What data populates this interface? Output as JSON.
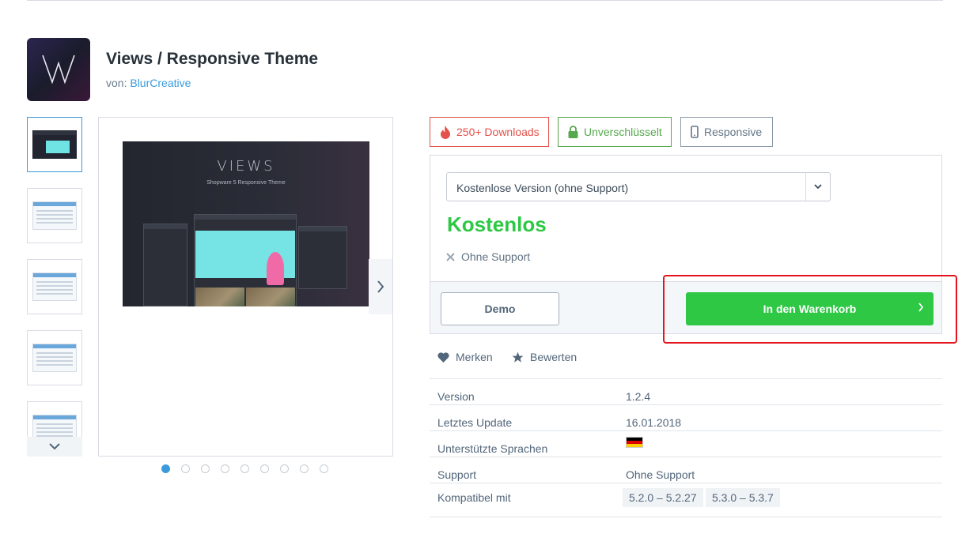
{
  "product": {
    "title": "Views / Responsive Theme",
    "by_prefix": "von:",
    "author": "BlurCreative"
  },
  "gallery": {
    "hero_brand": "VIEWS",
    "hero_subtitle": "Shopware 5 Responsive Theme",
    "hero_window_text": "views",
    "dot_count": 9,
    "active_dot": 1
  },
  "badges": {
    "downloads": "250+ Downloads",
    "encryption": "Unverschlüsselt",
    "responsive": "Responsive"
  },
  "buybox": {
    "version_select": "Kostenlose Version (ohne Support)",
    "price": "Kostenlos",
    "feature": "Ohne Support",
    "demo_label": "Demo",
    "cart_label": "In den Warenkorb"
  },
  "links": {
    "merken": "Merken",
    "bewerten": "Bewerten"
  },
  "details": {
    "version_label": "Version",
    "version_value": "1.2.4",
    "update_label": "Letztes Update",
    "update_value": "16.01.2018",
    "languages_label": "Unterstützte Sprachen",
    "support_label": "Support",
    "support_value": "Ohne Support",
    "compat_label": "Kompatibel mit",
    "compat_values": [
      "5.2.0 – 5.2.27",
      "5.3.0 – 5.3.7"
    ]
  },
  "colors": {
    "accent_blue": "#3a9bdc",
    "cta_green": "#2ec845",
    "downloads_red": "#e3514a",
    "lock_green": "#56a84e",
    "highlight_red": "#e3141e"
  },
  "icons": {
    "downloads": "flame-icon",
    "encryption": "lock-icon",
    "responsive": "mobile-icon",
    "select": "chevron-down-icon",
    "feature": "x-icon",
    "cart": "chevron-right-icon",
    "merken": "heart-icon",
    "bewerten": "star-icon",
    "thumbs_more": "chevron-down-icon",
    "gallery_next": "chevron-right-icon"
  }
}
